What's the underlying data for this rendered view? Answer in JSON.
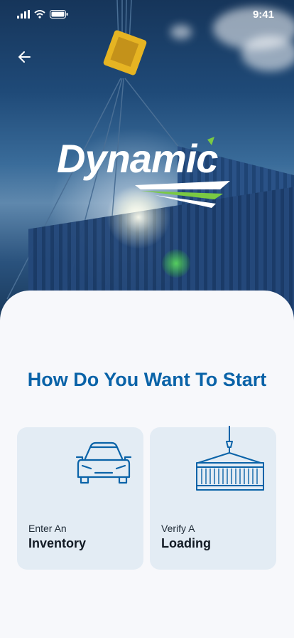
{
  "status_bar": {
    "time": "9:41",
    "icons": [
      "signal-icon",
      "wifi-icon",
      "battery-icon"
    ]
  },
  "header": {
    "back_icon": "arrow-left-icon"
  },
  "logo": {
    "text": "Dynamic",
    "accent_colors": [
      "#7ac943",
      "#ffffff"
    ]
  },
  "main": {
    "title": "How Do You Want To Start",
    "options": [
      {
        "line1": "Enter An",
        "line2": "Inventory",
        "icon": "car-icon"
      },
      {
        "line1": "Verify A",
        "line2": "Loading",
        "icon": "container-crane-icon"
      }
    ]
  },
  "colors": {
    "accent": "#0a63a8",
    "card_bg": "#e3ecf4",
    "sheet_bg": "#f7f8fb"
  }
}
